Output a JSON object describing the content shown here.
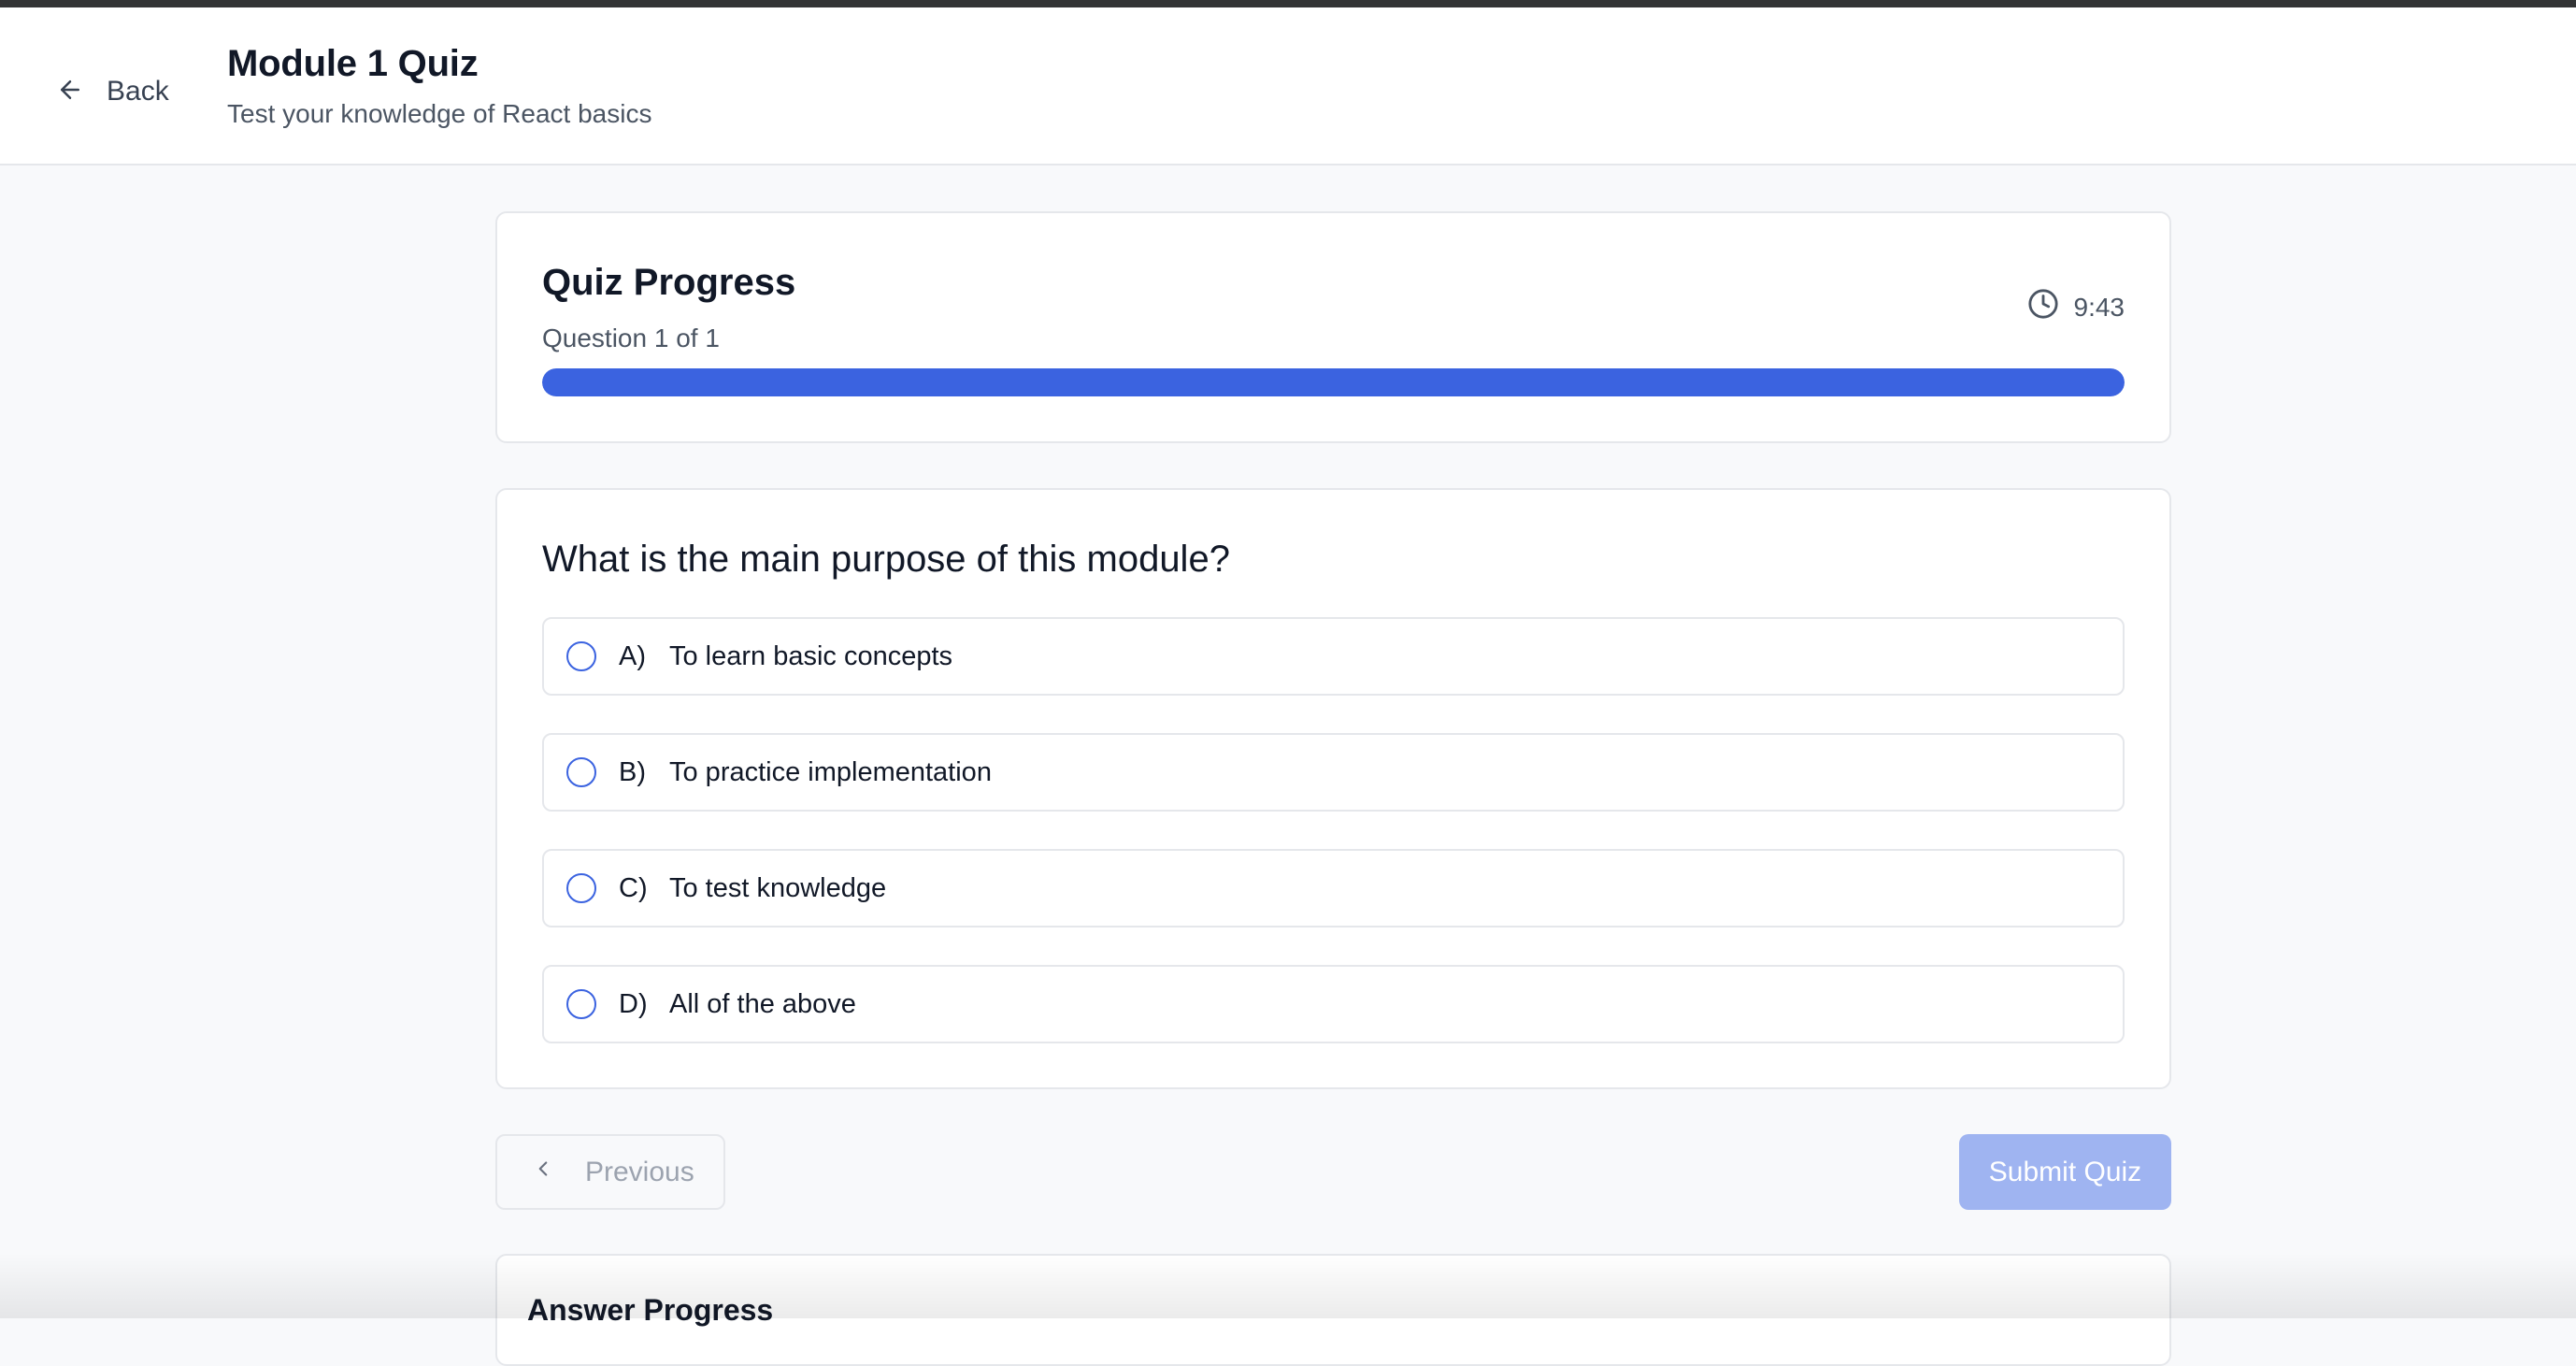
{
  "header": {
    "back_label": "Back",
    "title": "Module 1 Quiz",
    "subtitle": "Test your knowledge of React basics"
  },
  "progress": {
    "title": "Quiz Progress",
    "question_counter": "Question 1 of 1",
    "timer": "9:43",
    "percent": 100
  },
  "question": {
    "text": "What is the main purpose of this module?",
    "options": [
      {
        "letter": "A)",
        "text": "To learn basic concepts"
      },
      {
        "letter": "B)",
        "text": "To practice implementation"
      },
      {
        "letter": "C)",
        "text": "To test knowledge"
      },
      {
        "letter": "D)",
        "text": "All of the above"
      }
    ]
  },
  "nav": {
    "previous_label": "Previous",
    "submit_label": "Submit Quiz"
  },
  "answer_progress": {
    "title": "Answer Progress"
  },
  "colors": {
    "accent": "#3b63e0",
    "submit_disabled": "#9fb4f1"
  },
  "icons": {
    "back": "arrow-left-icon",
    "timer": "clock-icon",
    "previous": "chevron-left-icon"
  }
}
